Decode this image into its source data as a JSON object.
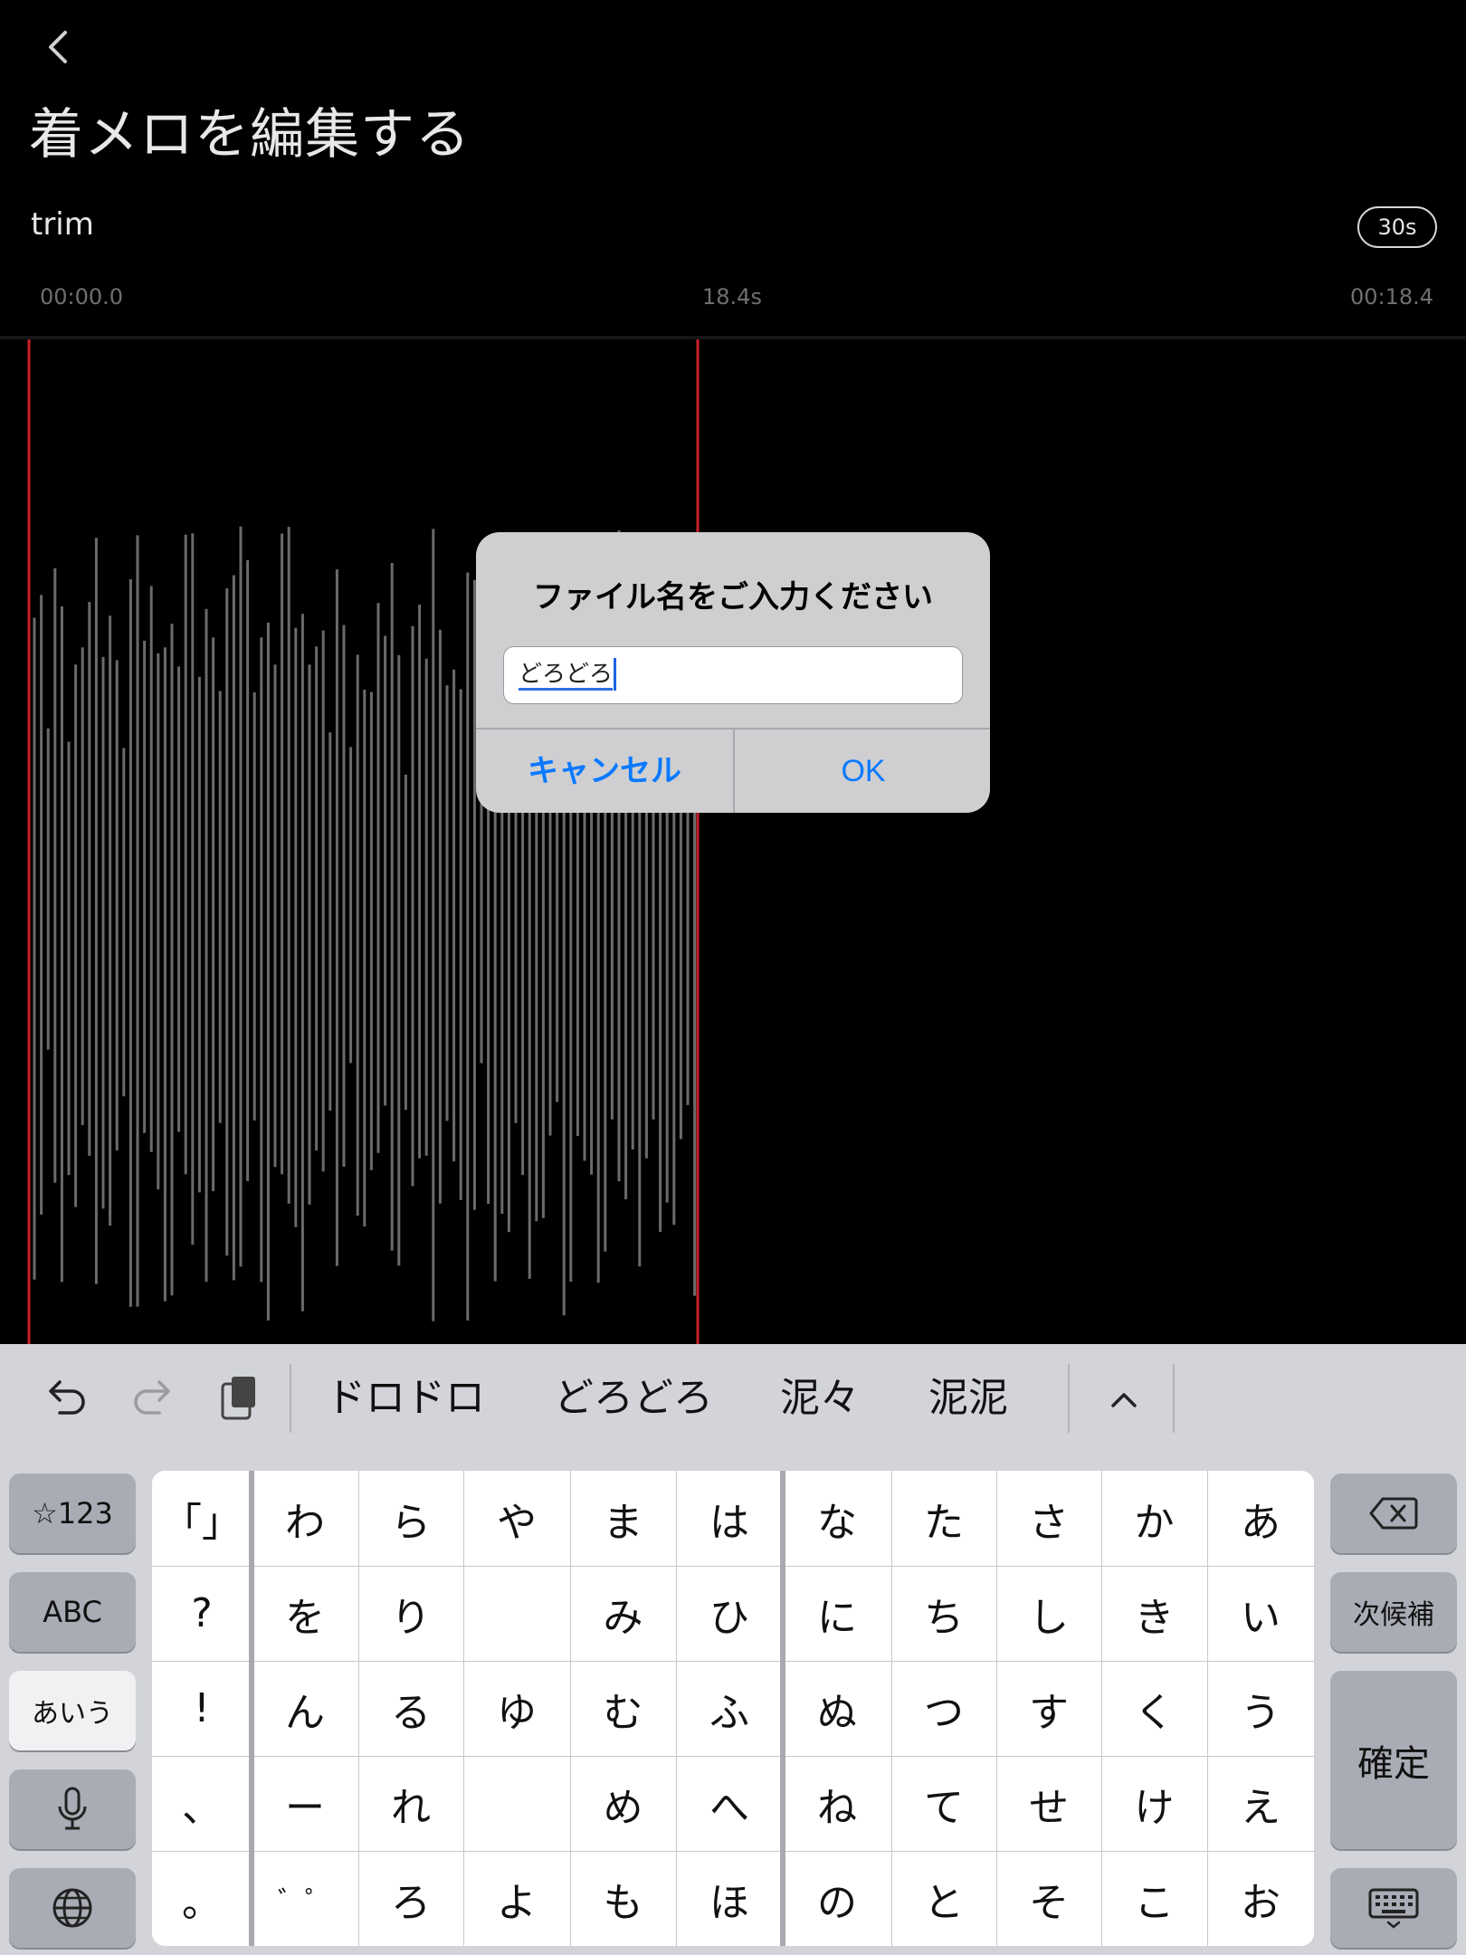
{
  "header": {
    "back_icon": "chevron-left-icon",
    "title": "着メロを編集する"
  },
  "editor": {
    "trim_label": "trim",
    "duration_badge": "30s",
    "time_start": "00:00.0",
    "time_mid": "18.4s",
    "time_end": "00:18.4"
  },
  "colors": {
    "background": "#000000",
    "waveform": "#6b6b6b",
    "trim_handle": "#c8202a",
    "accent": "#0a7aff"
  },
  "dialog": {
    "title": "ファイル名をご入力ください",
    "input_value": "どろどろ",
    "cancel_label": "キャンセル",
    "ok_label": "OK"
  },
  "keyboard": {
    "toolbar": {
      "undo_icon": "undo-icon",
      "redo_icon": "redo-icon",
      "paste_icon": "clipboard-icon",
      "candidates": [
        "ドロドロ",
        "どろどろ",
        "泥々",
        "泥泥"
      ],
      "expand_icon": "chevron-up-icon"
    },
    "left_keys": [
      "☆123",
      "ABC",
      "あいう"
    ],
    "right_keys": {
      "next_candidate": "次候補",
      "confirm": "確定"
    },
    "grid": [
      [
        "「」",
        "わ",
        "ら",
        "や",
        "ま",
        "は",
        "な",
        "た",
        "さ",
        "か",
        "あ"
      ],
      [
        "?",
        "を",
        "り",
        "",
        "み",
        "ひ",
        "に",
        "ち",
        "し",
        "き",
        "い"
      ],
      [
        "!",
        "ん",
        "る",
        "ゆ",
        "む",
        "ふ",
        "ぬ",
        "つ",
        "す",
        "く",
        "う"
      ],
      [
        "、",
        "ー",
        "れ",
        "",
        "め",
        "へ",
        "ね",
        "て",
        "せ",
        "け",
        "え"
      ],
      [
        "。",
        "゛゜",
        "ろ",
        "よ",
        "も",
        "ほ",
        "の",
        "と",
        "そ",
        "こ",
        "お"
      ]
    ]
  }
}
